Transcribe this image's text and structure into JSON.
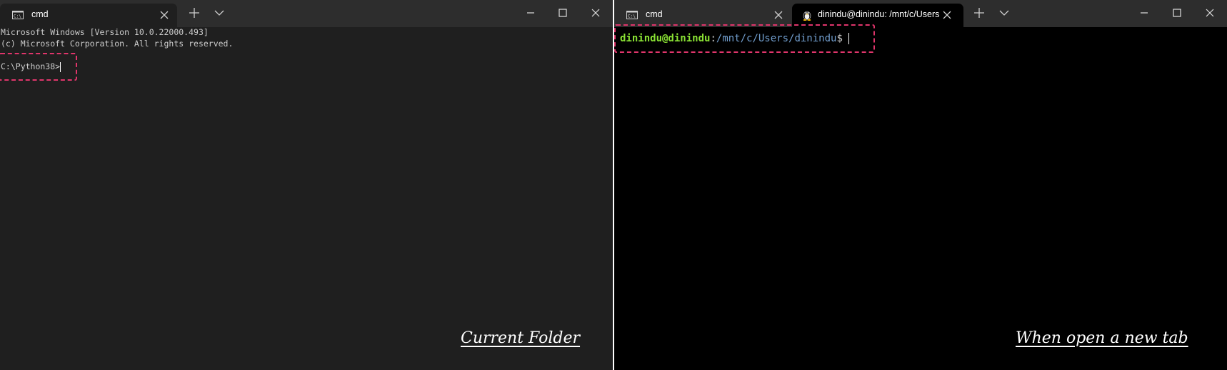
{
  "left_window": {
    "tabs": [
      {
        "label": "cmd",
        "icon": "cmd-icon",
        "active": true
      }
    ],
    "terminal": {
      "lines": [
        "Microsoft Windows [Version 10.0.22000.493]",
        "(c) Microsoft Corporation. All rights reserved."
      ],
      "prompt": "C:\\Python38>"
    },
    "caption": "Current Folder"
  },
  "right_window": {
    "tabs": [
      {
        "label": "cmd",
        "icon": "cmd-icon",
        "active": false
      },
      {
        "label": "dinindu@dinindu: /mnt/c/Users",
        "icon": "linux-tux-icon",
        "active": true
      }
    ],
    "terminal": {
      "user_host": "dinindu@dinindu",
      "separator": ":",
      "path": "/mnt/c/Users/dinindu",
      "symbol": "$"
    },
    "caption": "When open a new tab"
  },
  "colors": {
    "highlight_border": "#e0356b",
    "prompt_user_green": "#8ae234",
    "prompt_path_blue": "#729fcf"
  }
}
